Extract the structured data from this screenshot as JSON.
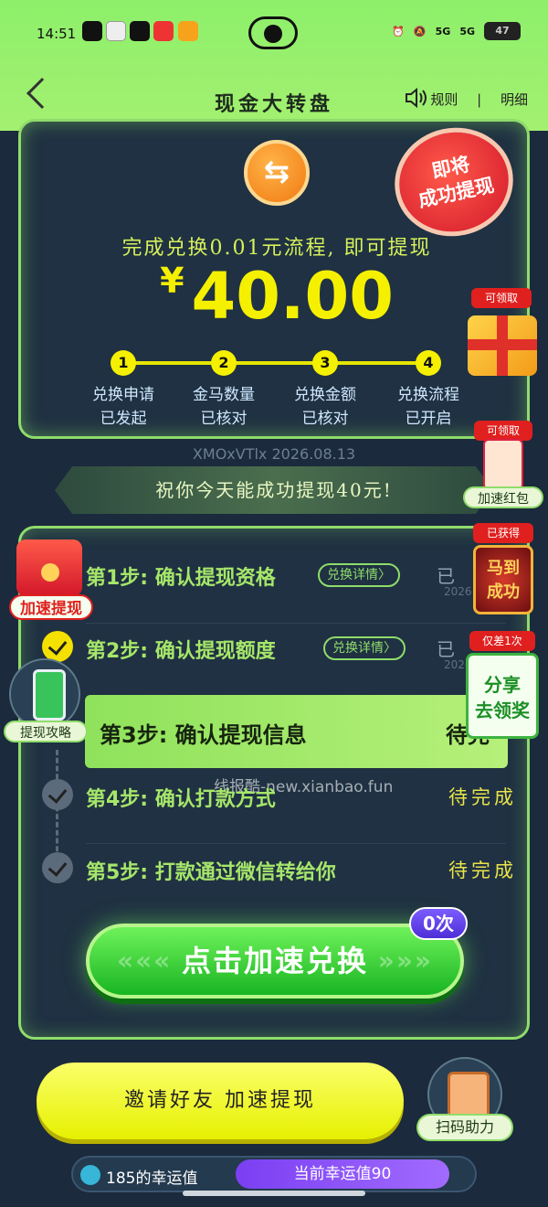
{
  "status_bar": {
    "time": "14:51",
    "signal_labels": [
      "5G",
      "5G"
    ],
    "battery": "47"
  },
  "header": {
    "title": "现金大转盘",
    "rules_label": "规则",
    "separator": "|",
    "details_label": "明细"
  },
  "exchange_card": {
    "swap_icon_glyph": "⇆",
    "subtitle": "完成兑换0.01元流程, 即可提现",
    "currency": "¥",
    "amount": "40.00",
    "seal_text": [
      "即将",
      "成功提现"
    ],
    "gift_tag": "可领取",
    "steps": [
      {
        "number": "1",
        "label": "兑换申请",
        "status": "已发起"
      },
      {
        "number": "2",
        "label": "金马数量",
        "status": "已核对"
      },
      {
        "number": "3",
        "label": "兑换金额",
        "status": "已核对"
      },
      {
        "number": "4",
        "label": "兑换流程",
        "status": "已开启"
      }
    ]
  },
  "code_date": "XMOxVTlx 2026.08.13",
  "wish_text": "祝你今天能成功提现40元!",
  "redpack_right": {
    "tag": "可领取",
    "label": "加速红包"
  },
  "steps_card": {
    "rows": [
      {
        "title": "第1步: 确认提现资格",
        "detail_label": "兑换详情〉",
        "state": "已",
        "date": "2026"
      },
      {
        "title": "第2步: 确认提现额度",
        "detail_label": "兑换详情〉",
        "state": "已",
        "date": "2026"
      },
      {
        "title": "第3步: 确认提现信息",
        "state": "待完"
      },
      {
        "title": "第4步: 确认打款方式",
        "state": "待完成"
      },
      {
        "title": "第5步: 打款通过微信转给你",
        "state": "待完成"
      }
    ],
    "accelerate_button": "点击加速兑换",
    "count_badge": "0次"
  },
  "watermark": "线报酷-new.xianbao.fun",
  "float_left": {
    "redpack_label": "加速提现",
    "guide_label": "提现攻略"
  },
  "float_right": {
    "horse_tag": "已获得",
    "horse_text": [
      "马到",
      "成功"
    ],
    "share_tag": "仅差1次",
    "share_text": [
      "分享",
      "去领奖"
    ]
  },
  "bottom": {
    "invite_button": "邀请好友 加速提现",
    "scan_help_label": "扫码助力",
    "luck_left": "185的幸运值",
    "luck_right": "当前幸运值90"
  },
  "colors": {
    "header_green": "#a4f071",
    "card_border": "#8fdc6b",
    "amount_yellow": "#f5f000",
    "button_green": "#19b523"
  }
}
